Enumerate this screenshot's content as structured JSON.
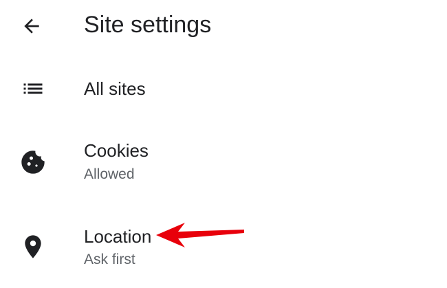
{
  "header": {
    "title": "Site settings",
    "back_icon": "arrow-back-icon"
  },
  "items": [
    {
      "label": "All sites",
      "icon": "list-icon"
    },
    {
      "label": "Cookies",
      "sublabel": "Allowed",
      "icon": "cookie-icon"
    },
    {
      "label": "Location",
      "sublabel": "Ask first",
      "icon": "location-pin-icon"
    }
  ],
  "colors": {
    "text_primary": "#202124",
    "text_secondary": "#5f6368",
    "icon": "#202124",
    "annotation_arrow": "#e8000b"
  }
}
